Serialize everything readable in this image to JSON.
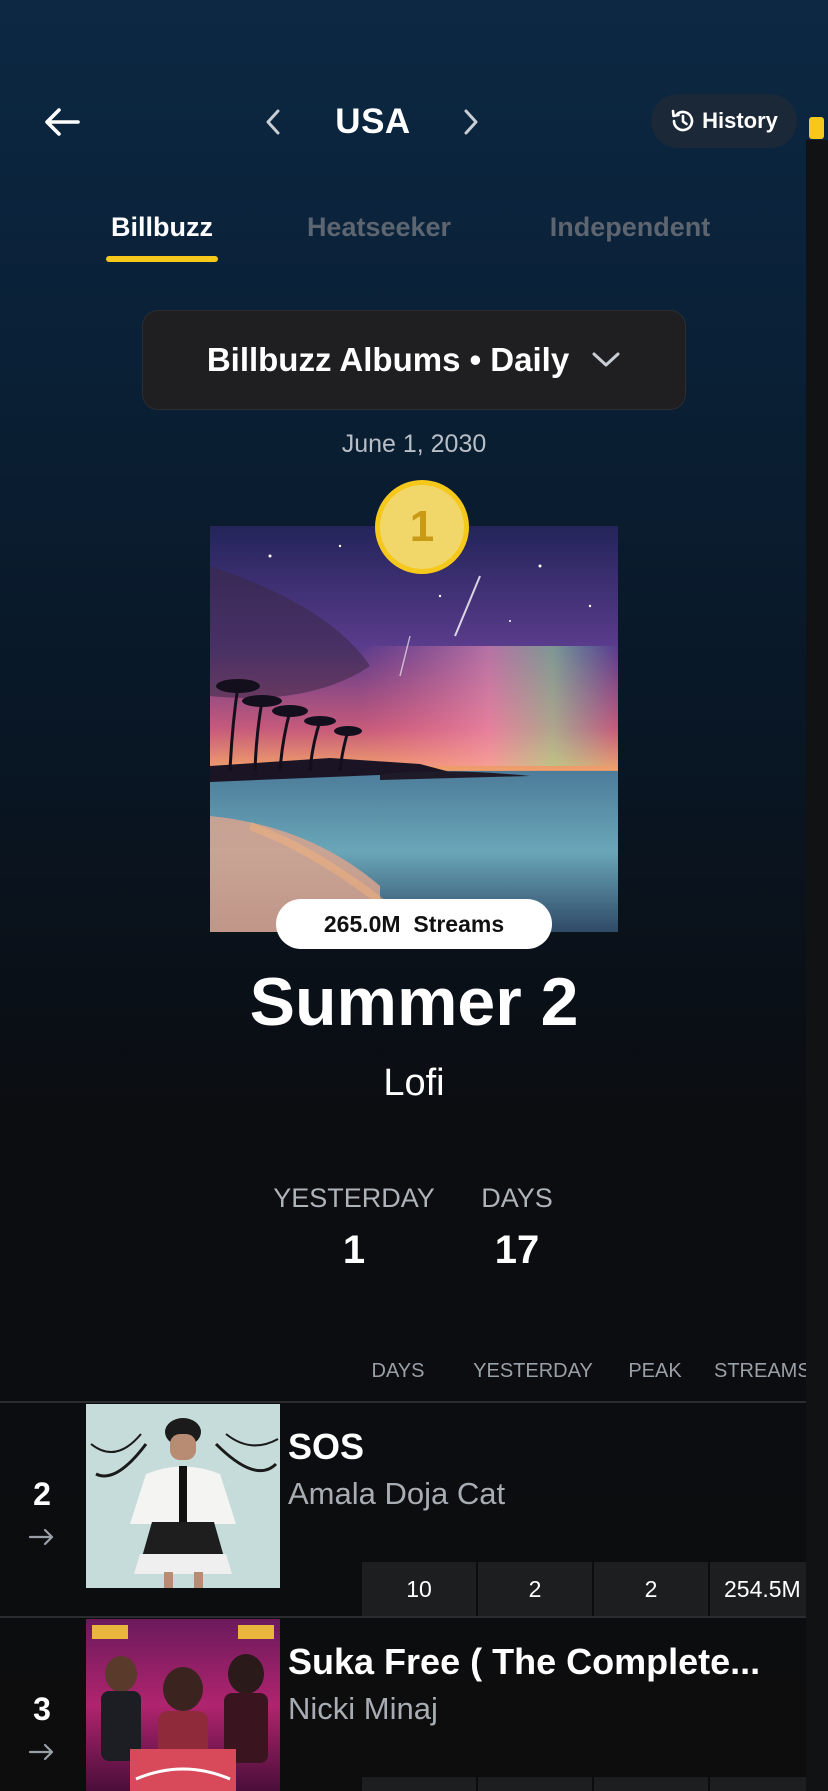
{
  "header": {
    "country": "USA",
    "history_label": "History"
  },
  "tabs": [
    {
      "label": "Billbuzz",
      "active": true
    },
    {
      "label": "Heatseeker",
      "active": false
    },
    {
      "label": "Independent",
      "active": false
    }
  ],
  "selector": {
    "label": "Billbuzz Albums • Daily"
  },
  "chart_date": "June 1, 2030",
  "top_entry": {
    "rank": "1",
    "streams_value": "265.0M",
    "streams_unit": "Streams",
    "title": "Summer 2",
    "artist": "Lofi",
    "stats": [
      {
        "label": "YESTERDAY",
        "value": "1"
      },
      {
        "label": "DAYS",
        "value": "17"
      }
    ]
  },
  "table": {
    "columns": [
      "DAYS",
      "YESTERDAY",
      "PEAK",
      "STREAMS"
    ],
    "rows": [
      {
        "rank": "2",
        "title": "SOS",
        "artist": "Amala Doja Cat",
        "days": "10",
        "yesterday": "2",
        "peak": "2",
        "streams": "254.5M"
      },
      {
        "rank": "3",
        "title": "Suka Free ( The Complete...",
        "artist": "Nicki Minaj",
        "days": "",
        "yesterday": "",
        "peak": "",
        "streams": ""
      }
    ]
  },
  "colors": {
    "accent": "#f6c81b",
    "inactive_tab": "#5d6570",
    "cell_bg": "#1d1e20"
  },
  "icons": [
    "back-arrow-icon",
    "chevron-left-icon",
    "chevron-right-icon",
    "history-clock-icon",
    "chevron-down-icon",
    "move-arrow-icon"
  ]
}
